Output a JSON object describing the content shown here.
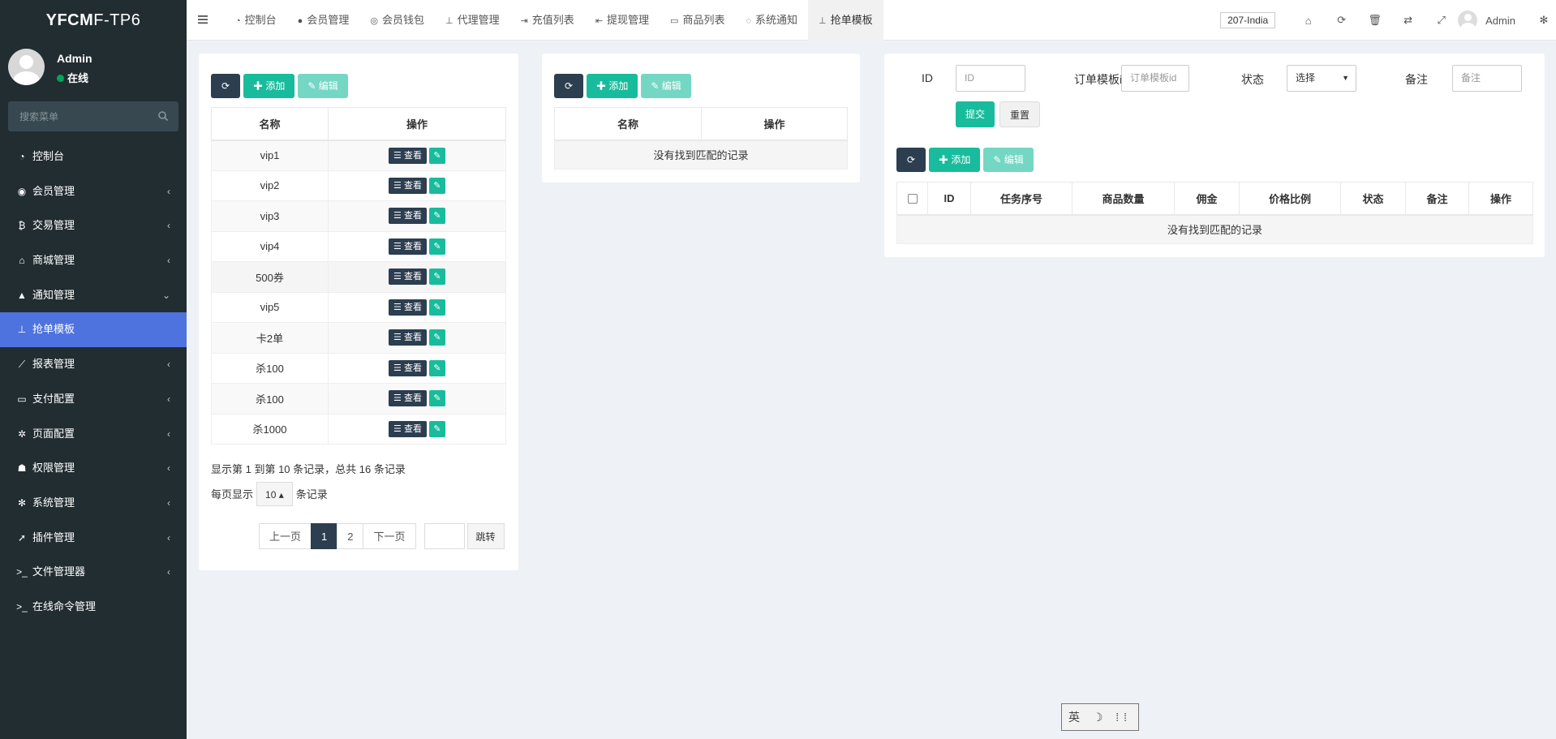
{
  "app": {
    "logo_bold": "YFCM",
    "logo_rest": "F-TP6"
  },
  "user": {
    "name": "Admin",
    "status": "在线"
  },
  "search": {
    "placeholder": "搜索菜单"
  },
  "menu": [
    {
      "icon": "dashboard-icon",
      "glyph": "◔",
      "label": "控制台",
      "arrow": ""
    },
    {
      "icon": "user-circle-icon",
      "glyph": "◉",
      "label": "会员管理",
      "arrow": "‹"
    },
    {
      "icon": "bitcoin-icon",
      "glyph": "₿",
      "label": "交易管理",
      "arrow": "‹"
    },
    {
      "icon": "home-icon",
      "glyph": "⌂",
      "label": "商城管理",
      "arrow": "‹"
    },
    {
      "icon": "bell-icon",
      "glyph": "▲",
      "label": "通知管理",
      "arrow": "⌄"
    },
    {
      "icon": "sitemap-icon",
      "glyph": "⊥",
      "label": "抢单模板",
      "arrow": ""
    },
    {
      "icon": "line-chart-icon",
      "glyph": "⟋",
      "label": "报表管理",
      "arrow": "‹"
    },
    {
      "icon": "credit-card-icon",
      "glyph": "▭",
      "label": "支付配置",
      "arrow": "‹"
    },
    {
      "icon": "gear-icon",
      "glyph": "✲",
      "label": "页面配置",
      "arrow": "‹"
    },
    {
      "icon": "users-icon",
      "glyph": "☗",
      "label": "权限管理",
      "arrow": "‹"
    },
    {
      "icon": "gears-icon",
      "glyph": "✻",
      "label": "系统管理",
      "arrow": "‹"
    },
    {
      "icon": "rocket-icon",
      "glyph": "➚",
      "label": "插件管理",
      "arrow": "‹"
    },
    {
      "icon": "terminal-icon",
      "glyph": ">_",
      "label": "文件管理器",
      "arrow": "‹"
    },
    {
      "icon": "terminal-icon",
      "glyph": ">_",
      "label": "在线命令管理",
      "arrow": ""
    }
  ],
  "tabs": [
    {
      "icon": "dashboard-icon",
      "glyph": "◔",
      "label": "控制台"
    },
    {
      "icon": "user-icon",
      "glyph": "●",
      "label": "会员管理"
    },
    {
      "icon": "wallet-icon",
      "glyph": "◎",
      "label": "会员钱包"
    },
    {
      "icon": "sitemap-icon",
      "glyph": "⊥",
      "label": "代理管理"
    },
    {
      "icon": "sign-in-icon",
      "glyph": "⇥",
      "label": "充值列表"
    },
    {
      "icon": "sign-out-icon",
      "glyph": "⇤",
      "label": "提现管理"
    },
    {
      "icon": "desktop-icon",
      "glyph": "▭",
      "label": "商品列表"
    },
    {
      "icon": "comments-icon",
      "glyph": "◌",
      "label": "系统通知"
    },
    {
      "icon": "sitemap-icon",
      "glyph": "⊥",
      "label": "抢单模板"
    }
  ],
  "navbar": {
    "lang": "207-India",
    "admin": "Admin"
  },
  "toolbar": {
    "add": "添加",
    "edit": "编辑"
  },
  "left_table": {
    "headers": [
      "名称",
      "操作"
    ],
    "rows": [
      "vip1",
      "vip2",
      "vip3",
      "vip4",
      "500券",
      "vip5",
      "卡2单",
      "杀100",
      "杀100",
      "杀1000"
    ],
    "view_label": "查看"
  },
  "pager": {
    "info": "显示第 1 到第 10 条记录，总共 16 条记录",
    "per_page_prefix": "每页显示",
    "per_page_value": "10",
    "per_page_suffix": "条记录",
    "prev": "上一页",
    "pages": [
      "1",
      "2"
    ],
    "next": "下一页",
    "go": "跳转"
  },
  "middle_table": {
    "headers": [
      "名称",
      "操作"
    ],
    "empty": "没有找到匹配的记录"
  },
  "filter": {
    "id_label": "ID",
    "id_placeholder": "ID",
    "tpl_label": "订单模板id",
    "tpl_placeholder": "订单模板id",
    "status_label": "状态",
    "status_value": "选择",
    "remark_label": "备注",
    "remark_placeholder": "备注",
    "submit": "提交",
    "reset": "重置"
  },
  "right_table": {
    "headers": [
      "ID",
      "任务序号",
      "商品数量",
      "佣金",
      "价格比例",
      "状态",
      "备注",
      "操作"
    ],
    "empty": "没有找到匹配的记录"
  },
  "ime": {
    "text": "英 ☽ ⁞⁞"
  }
}
